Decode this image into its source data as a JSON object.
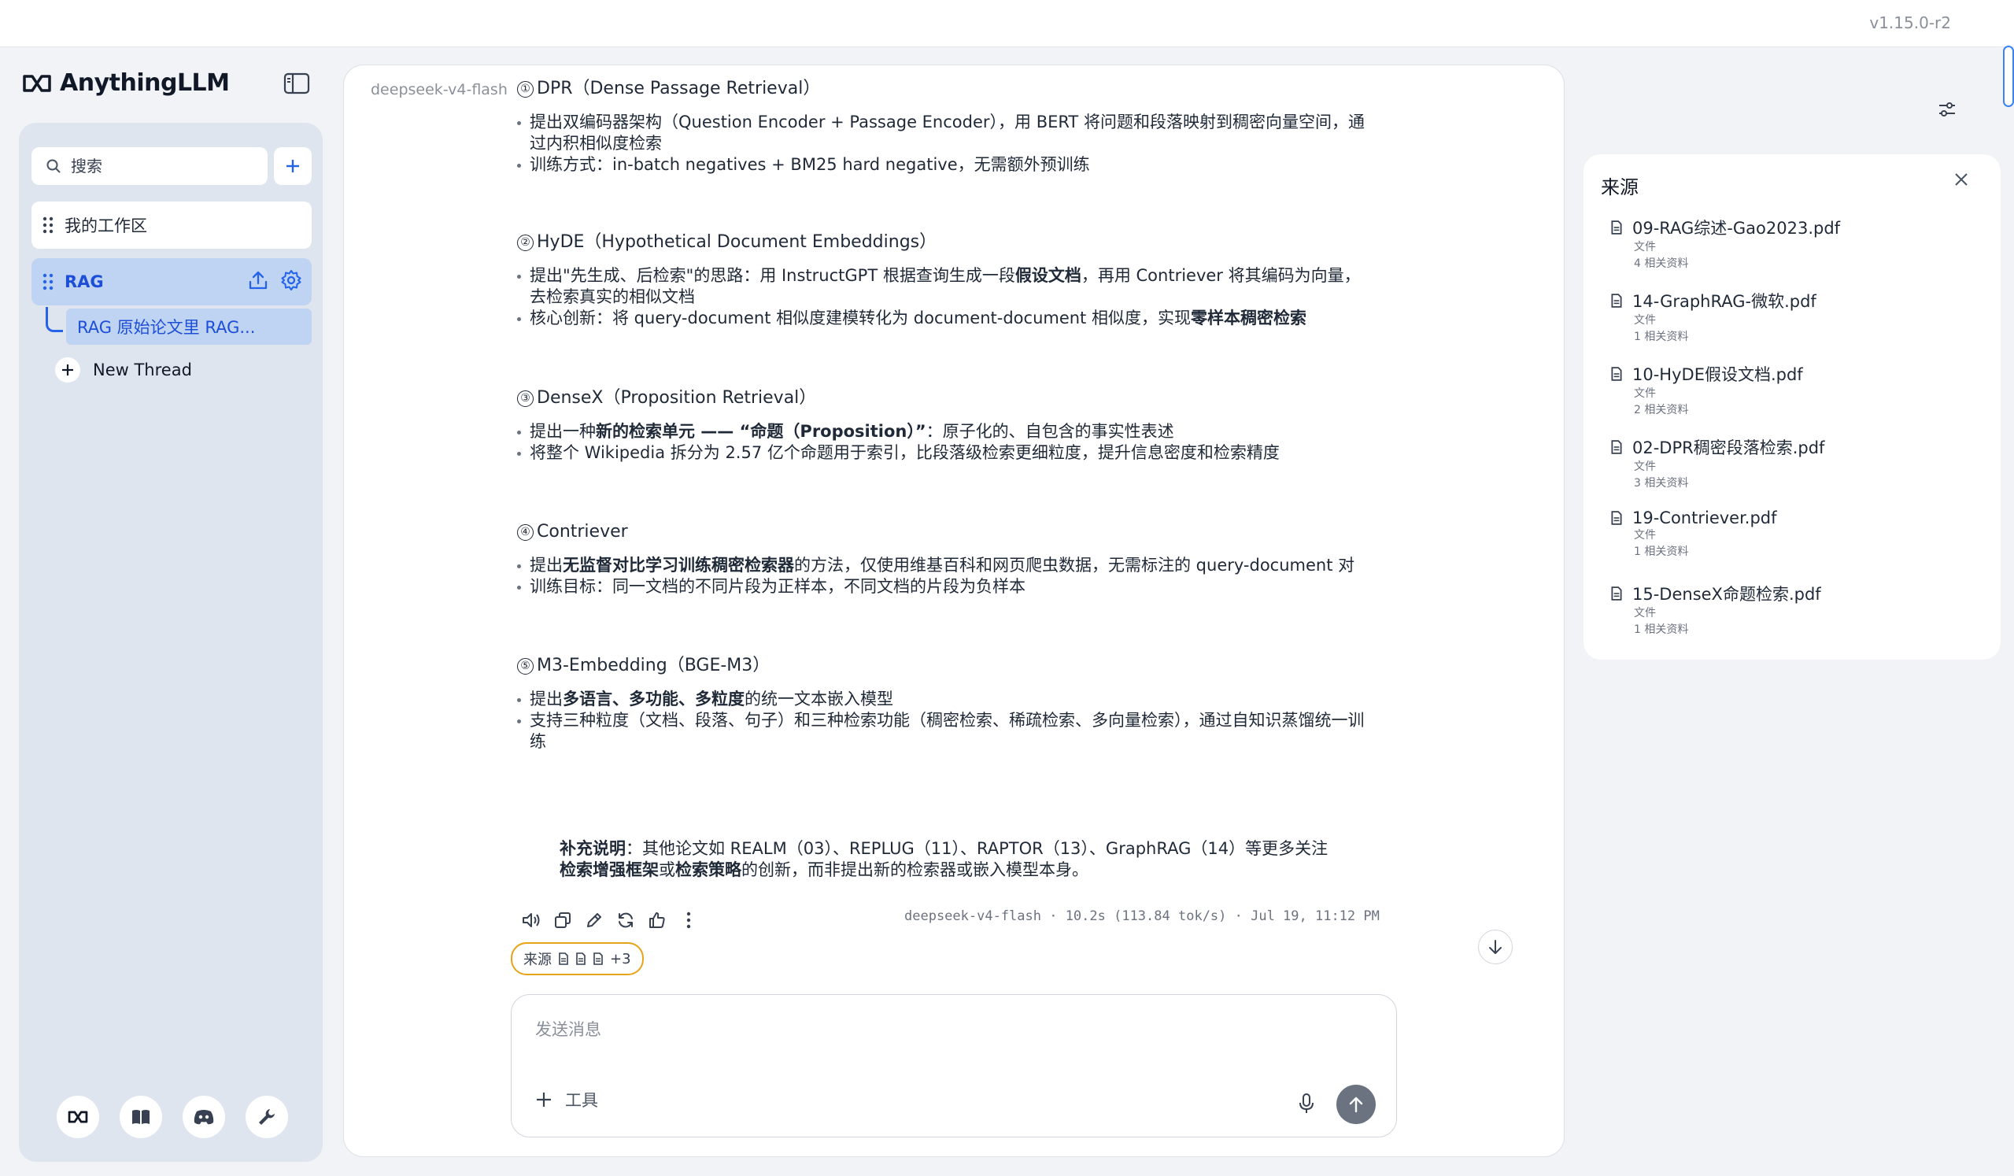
{
  "app": {
    "name": "AnythingLLM",
    "version": "v1.15.0-r2"
  },
  "sidebar": {
    "search_placeholder": "搜索",
    "workspaces": [
      {
        "name": "我的工作区"
      },
      {
        "name": "RAG",
        "active": true
      }
    ],
    "thread": "RAG 原始论文里 RAG...",
    "new_thread": "New Thread"
  },
  "chat": {
    "model": "deepseek-v4-flash",
    "sections": [
      {
        "num": "①",
        "title": "DPR（Dense Passage Retrieval）",
        "b1": "提出双编码器架构（Question Encoder + Passage Encoder），用 BERT 将问题和段落映射到稠密向量空间，通过内积相似度检索",
        "b2": "训练方式：in-batch negatives + BM25 hard negative，无需额外预训练"
      },
      {
        "num": "②",
        "title": "HyDE（Hypothetical Document Embeddings）",
        "b1_pre": "提出\"先生成、后检索\"的思路：用 InstructGPT 根据查询生成一段",
        "b1_bold": "假设文档",
        "b1_post": "，再用 Contriever 将其编码为向量，去检索真实的相似文档",
        "b2_pre": "核心创新：将 query-document 相似度建模转化为 document-document 相似度，实现",
        "b2_bold": "零样本稠密检索"
      },
      {
        "num": "③",
        "title": "DenseX（Proposition Retrieval）",
        "b1_pre": "提出一种",
        "b1_bold": "新的检索单元 —— “命题（Proposition）”",
        "b1_post": "：原子化的、自包含的事实性表述",
        "b2": "将整个 Wikipedia 拆分为 2.57 亿个命题用于索引，比段落级检索更细粒度，提升信息密度和检索精度"
      },
      {
        "num": "④",
        "title": "Contriever",
        "b1_pre": "提出",
        "b1_bold": "无监督对比学习训练稠密检索器",
        "b1_post": "的方法，仅使用维基百科和网页爬虫数据，无需标注的 query-document 对",
        "b2": "训练目标：同一文档的不同片段为正样本，不同文档的片段为负样本"
      },
      {
        "num": "⑤",
        "title": "M3-Embedding（BGE-M3）",
        "b1_pre": "提出",
        "b1_bold": "多语言、多功能、多粒度",
        "b1_post": "的统一文本嵌入模型",
        "b2": "支持三种粒度（文档、段落、句子）和三种检索功能（稠密检索、稀疏检索、多向量检索），通过自知识蒸馏统一训练"
      }
    ],
    "note": {
      "label": "补充说明",
      "t1": "：其他论文如 REALM（03）、REPLUG（11）、RAPTOR（13）、GraphRAG（14）等更多关注",
      "b1": "检索增强框架",
      "t2": "或",
      "b2": "检索策略",
      "t3": "的创新，而非提出新的检索器或嵌入模型本身。"
    },
    "meta": "deepseek-v4-flash · 10.2s (113.84 tok/s) · Jul 19, 11:12 PM",
    "sources_chip": {
      "label": "来源",
      "more": "+3"
    },
    "composer_placeholder": "发送消息",
    "tools_label": "工具"
  },
  "sources_panel": {
    "title": "来源",
    "items": [
      {
        "name": "09-RAG综述-Gao2023.pdf",
        "type": "文件",
        "count": "4 相关资料"
      },
      {
        "name": "14-GraphRAG-微软.pdf",
        "type": "文件",
        "count": "1 相关资料"
      },
      {
        "name": "10-HyDE假设文档.pdf",
        "type": "文件",
        "count": "2 相关资料"
      },
      {
        "name": "02-DPR稠密段落检索.pdf",
        "type": "文件",
        "count": "3 相关资料"
      },
      {
        "name": "19-Contriever.pdf",
        "type": "文件",
        "count": "1 相关资料"
      },
      {
        "name": "15-DenseX命题检索.pdf",
        "type": "文件",
        "count": "1 相关资料"
      }
    ]
  },
  "colors": {
    "accent": "#2563eb",
    "active_bg": "#bfd4f2",
    "sidebar_bg": "#dfe5ee",
    "chip_border": "#e8a317"
  }
}
